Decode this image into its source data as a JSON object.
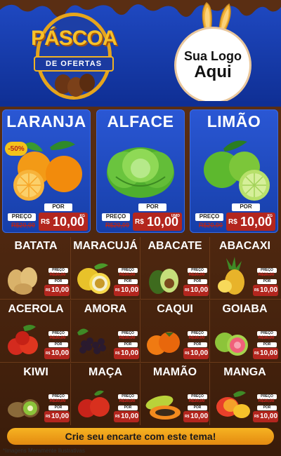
{
  "header": {
    "title_main": "PÁSCOA",
    "title_ribbon": "DE OFERTAS",
    "logo_line1": "Sua Logo",
    "logo_line2": "Aqui"
  },
  "featured": [
    {
      "name": "LARANJA",
      "badge": "-50%",
      "por_label": "POR",
      "preco_label": "PREÇO",
      "old_price": "R$20,00",
      "currency": "R$",
      "price": "10,00",
      "unit": "KG"
    },
    {
      "name": "ALFACE",
      "por_label": "POR",
      "preco_label": "PREÇO",
      "old_price": "R$20,00",
      "currency": "R$",
      "price": "10,00",
      "unit": "UNID"
    },
    {
      "name": "LIMÃO",
      "por_label": "POR",
      "preco_label": "PREÇO",
      "old_price": "R$20,00",
      "currency": "R$",
      "price": "10,00",
      "unit": "KG"
    }
  ],
  "products": [
    {
      "name": "BATATA",
      "preco_label": "PREÇO",
      "old_price": "R$20,00",
      "por_label": "POR",
      "currency": "R$",
      "price": "10,00"
    },
    {
      "name": "MARACUJÁ",
      "preco_label": "PREÇO",
      "old_price": "R$20,00",
      "por_label": "POR",
      "currency": "R$",
      "price": "10,00"
    },
    {
      "name": "ABACATE",
      "preco_label": "PREÇO",
      "old_price": "R$20,00",
      "por_label": "POR",
      "currency": "R$",
      "price": "10,00"
    },
    {
      "name": "ABACAXI",
      "preco_label": "PREÇO",
      "old_price": "R$20,00",
      "por_label": "POR",
      "currency": "R$",
      "price": "10,00"
    },
    {
      "name": "ACEROLA",
      "preco_label": "PREÇO",
      "old_price": "R$20,00",
      "por_label": "POR",
      "currency": "R$",
      "price": "10,00"
    },
    {
      "name": "AMORA",
      "preco_label": "PREÇO",
      "old_price": "R$20,00",
      "por_label": "POR",
      "currency": "R$",
      "price": "10,00"
    },
    {
      "name": "CAQUI",
      "preco_label": "PREÇO",
      "old_price": "R$20,00",
      "por_label": "POR",
      "currency": "R$",
      "price": "10,00"
    },
    {
      "name": "GOIABA",
      "preco_label": "PREÇO",
      "old_price": "R$20,00",
      "por_label": "POR",
      "currency": "R$",
      "price": "10,00"
    },
    {
      "name": "KIWI",
      "preco_label": "PREÇO",
      "old_price": "R$20,00",
      "por_label": "POR",
      "currency": "R$",
      "price": "10,00"
    },
    {
      "name": "MAÇA",
      "preco_label": "PREÇO",
      "old_price": "R$20,00",
      "por_label": "POR",
      "currency": "R$",
      "price": "10,00"
    },
    {
      "name": "MAMÃO",
      "preco_label": "PREÇO",
      "old_price": "R$20,00",
      "por_label": "POR",
      "currency": "R$",
      "price": "10,00"
    },
    {
      "name": "MANGA",
      "preco_label": "PREÇO",
      "old_price": "R$20,00",
      "por_label": "POR",
      "currency": "R$",
      "price": "10,00"
    }
  ],
  "cta": "Crie seu encarte com este tema!",
  "footnote": "*Imagens Meramente Ilustrativas",
  "colors": {
    "blue": "#1f49c2",
    "chocolate": "#4a240e",
    "orange": "#f09a1c",
    "price_red": "#b3261e"
  }
}
